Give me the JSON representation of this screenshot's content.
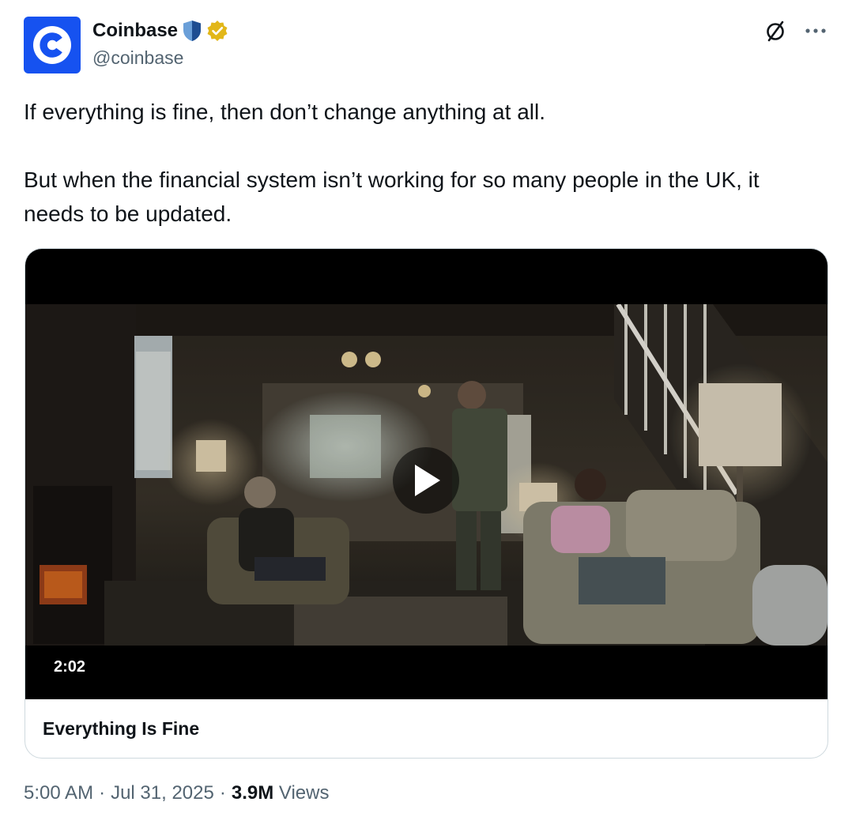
{
  "author": {
    "display_name": "Coinbase",
    "handle": "@coinbase",
    "avatar_icon": "coinbase-logo-icon",
    "affiliate_badge_icon": "shield-badge-icon",
    "verified_badge_icon": "gold-verified-badge-icon",
    "brand_color": "#1652f0"
  },
  "top_actions": {
    "grok_icon": "slashed-circle-icon",
    "more_icon": "more-horizontal-icon"
  },
  "tweet": {
    "paragraphs": [
      "If everything is fine, then don’t change anything at all.",
      "But when the financial system isn’t working for so many people in the UK, it needs to be updated."
    ]
  },
  "media": {
    "duration": "2:02",
    "title": "Everything Is Fine",
    "play_icon": "play-icon"
  },
  "meta": {
    "time": "5:00 AM",
    "sep1": "·",
    "date": "Jul 31, 2025",
    "sep2": "·",
    "views_count": "3.9M",
    "views_label": "Views"
  }
}
